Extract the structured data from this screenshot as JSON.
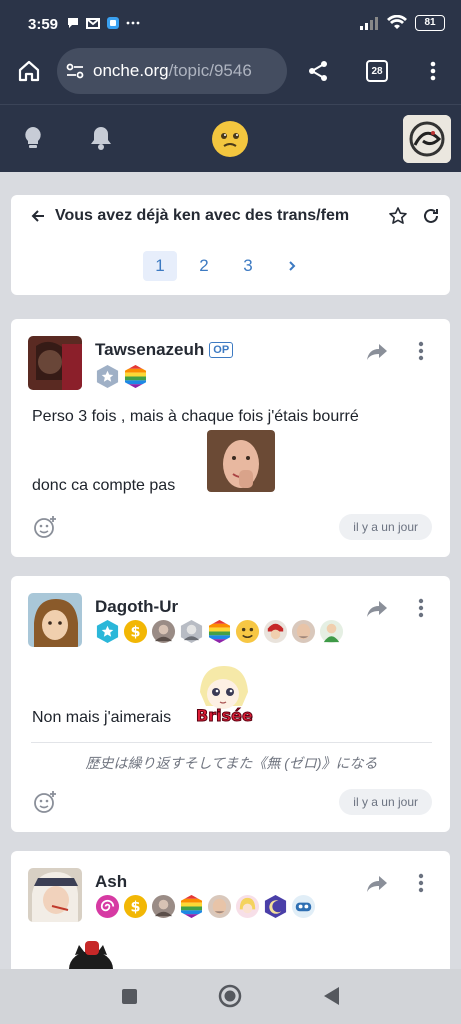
{
  "status_bar": {
    "time": "3:59",
    "battery": "81"
  },
  "browser": {
    "url_host": "onche.org",
    "url_path": "/topic/9546",
    "tab_count": "28"
  },
  "topic": {
    "title": "Vous avez déjà ken avec des trans/fem",
    "pages": [
      "1",
      "2",
      "3"
    ],
    "current_page": "1"
  },
  "posts": [
    {
      "author": "Tawsenazeuh",
      "op_label": "OP",
      "line1": "Perso 3 fois , mais à chaque fois j'étais bourré",
      "line2": "donc ca compte pas",
      "time": "il y a un jour"
    },
    {
      "author": "Dagoth-Ur",
      "text": "Non mais j'aimerais",
      "sticker_text": "Brisée",
      "signature": "歴史は繰り返すそしてまた《無 (ゼロ)》になる",
      "time": "il y a un jour"
    },
    {
      "author": "Ash"
    }
  ],
  "colors": {
    "header_bg": "#2b3448",
    "accent": "#3d7ac2",
    "page_bg": "#d9dbe0"
  }
}
